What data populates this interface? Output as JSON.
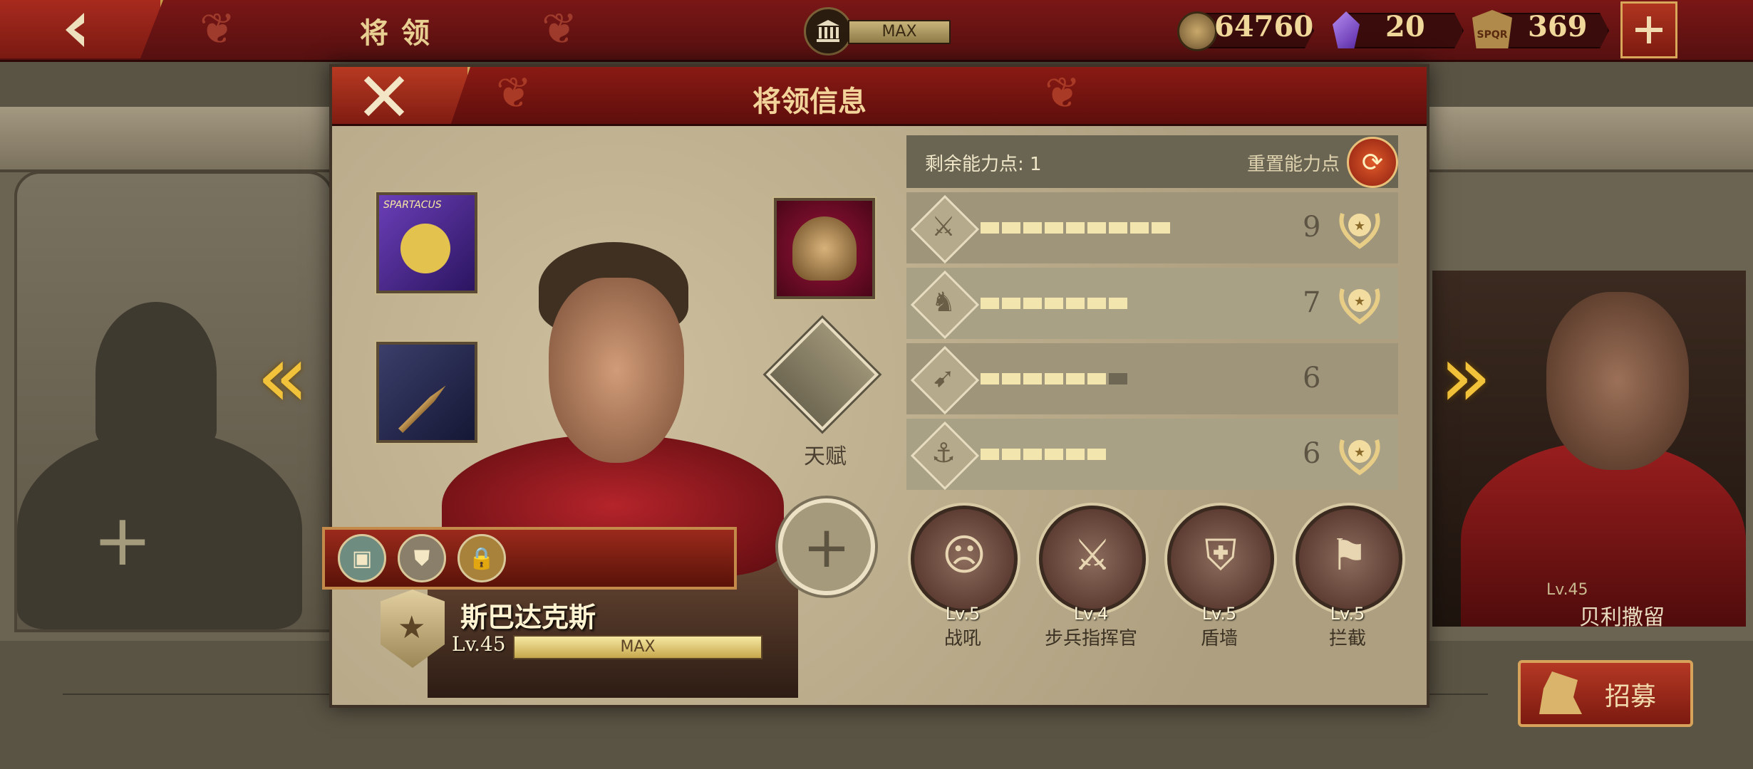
{
  "screen": {
    "title": "将领"
  },
  "top_bar": {
    "level_max_label": "MAX",
    "resources": [
      {
        "icon": "coin-icon",
        "value": "64760"
      },
      {
        "icon": "gem-icon",
        "value": "20"
      },
      {
        "icon": "spqr-badge-icon",
        "value": "369"
      }
    ],
    "spqr_text": "SPQR"
  },
  "background": {
    "right_general": {
      "name": "贝利撒留",
      "level": "Lv.45"
    }
  },
  "recruit_button": {
    "label": "招募"
  },
  "modal": {
    "title": "将领信息",
    "equipment": {
      "banner_text": "SPARTACUS"
    },
    "talent_label": "天赋",
    "general": {
      "name": "斯巴达克斯",
      "level": "Lv.45",
      "exp_label": "MAX",
      "exp_fraction": 1.0
    },
    "ability_points": {
      "remaining_label": "剩余能力点:",
      "remaining_value": "1",
      "reset_label": "重置能力点"
    },
    "stats": [
      {
        "icon": "sword-icon",
        "value": "9",
        "filled": 9,
        "total": 9,
        "rank_badge": true
      },
      {
        "icon": "horse-icon",
        "value": "7",
        "filled": 7,
        "total": 7,
        "rank_badge": true
      },
      {
        "icon": "bow-icon",
        "value": "6",
        "filled": 6,
        "total": 7,
        "rank_badge": false
      },
      {
        "icon": "anchor-icon",
        "value": "6",
        "filled": 6,
        "total": 6,
        "rank_badge": true
      }
    ],
    "skills": [
      {
        "icon": "war-cry-icon",
        "level": "Lv.5",
        "name": "战吼"
      },
      {
        "icon": "crossed-swords-icon",
        "level": "Lv.4",
        "name": "步兵指挥官"
      },
      {
        "icon": "shield-wall-icon",
        "level": "Lv.5",
        "name": "盾墙"
      },
      {
        "icon": "intercept-icon",
        "level": "Lv.5",
        "name": "拦截"
      }
    ]
  },
  "colors": {
    "header_red": "#7a1616",
    "panel_tan": "#b9ad8e",
    "stat_bar_fill": "#f2e6ae",
    "stat_bar_empty": "#6e6754",
    "nav_arrow_gold": "#f2c23a"
  }
}
